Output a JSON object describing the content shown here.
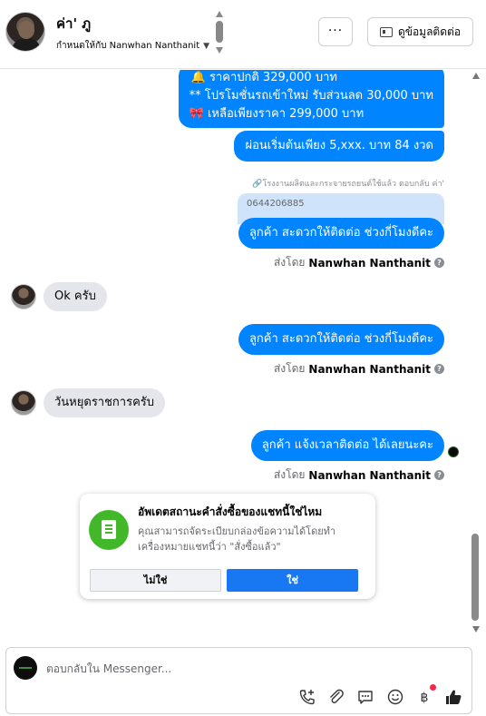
{
  "header": {
    "contact_name": "ค่า' ภู",
    "assign_label": "กำหนดให้กับ Nanwhan Nanthanit",
    "more_label": "···",
    "contact_info_button": "ดูข้อมูลติดต่อ"
  },
  "messages": {
    "promo_line1": "🔔 ราคาปกติ 329,000 บาท",
    "promo_line2": "** โปรโมชั่นรถเข้าใหม่ รับส่วนลด 30,000 บาท",
    "promo_line3": "🎀  เหลือเพียงราคา 299,000 บาท",
    "installment": "ผ่อนเริ่มต้นเพียง 5,xxx. บาท 84 งวด",
    "reply_ref": "🔗โรงงานผลิตและกระจายรถยนต์ใช้แล้ว ตอบกลับ ค่า'",
    "quoted_phone": "0644206885",
    "out1": "ลูกค้า สะดวกให้ติดต่อ ช่วงกี่โมงดีคะ",
    "sent_by_prefix": "ส่งโดย",
    "sent_by_name": "Nanwhan Nanthanit",
    "in1": "Ok ครับ",
    "out2": "ลูกค้า สะดวกให้ติดต่อ ช่วงกี่โมงดีคะ",
    "in2": "วันหยุดราชการครับ",
    "out3": "ลูกค้า แจ้งเวลาติดต่อ ได้เลยนะคะ"
  },
  "status_card": {
    "title": "อัพเดตสถานะคำสั่งซื้อของแชทนี้ใช่ไหม",
    "description": "คุณสามารถจัดระเบียบกล่องข้อความได้โดยทำเครื่องหมายแชทนี้ว่า \"สั่งซื้อแล้ว\"",
    "no_label": "ไม่ใช่",
    "yes_label": "ใช่"
  },
  "composer": {
    "placeholder": "ตอบกลับใน Messenger..."
  },
  "icons": {
    "call": "phone-plus-icon",
    "attach": "paperclip-icon",
    "saved_reply": "chat-bubble-icon",
    "emoji": "smiley-icon",
    "payment": "baht-icon",
    "like": "thumbs-up-icon"
  },
  "colors": {
    "outgoing_bubble": "#0084ff",
    "incoming_bubble": "#e4e6eb",
    "primary_button": "#1877f2",
    "card_icon": "#42b72a",
    "notification": "#f02849"
  }
}
